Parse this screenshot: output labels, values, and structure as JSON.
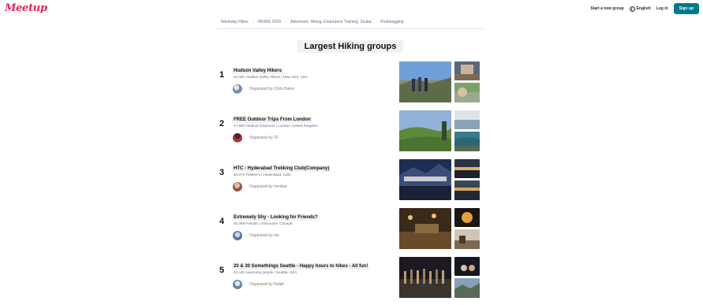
{
  "header": {
    "logo": "Meetup",
    "start_group": "Start a new group",
    "language": "English",
    "login": "Log in",
    "signup": "Sign up",
    "accent_color": "#00798a",
    "brand_color": "#e32359"
  },
  "breadcrumb": {
    "items": [
      "Weekday Hikes",
      "HIKING DOG",
      "Adventure, Hiking, Endurance Training, Scuba",
      "Peakbagging"
    ]
  },
  "page": {
    "title": "Largest Hiking groups"
  },
  "groups": [
    {
      "rank": "1",
      "name": "Hudson Valley Hikers",
      "meta": "54,481 Hudson Valley Hikers | New York, USA",
      "organizer": "Organized by Chris Baker"
    },
    {
      "rank": "2",
      "name": "FREE Outdoor Trips From London",
      "meta": "47,993 Outdoor Explorers | London, United Kingdom",
      "organizer": "Organized by TF"
    },
    {
      "rank": "3",
      "name": "HTC - Hyderabad Trekking Club(Company)",
      "meta": "46,074 Trekker's | Hyderabad, India",
      "organizer": "Organized by Venkee"
    },
    {
      "rank": "4",
      "name": "Extremely Shy - Looking for Friends?",
      "meta": "45,069 Friends | Vancouver, Canada",
      "organizer": "Organized by Ian"
    },
    {
      "rank": "5",
      "name": "20 & 30 Somethings Seattle - Happy hours to hikes - All fun!",
      "meta": "42,440 Awesome people | Seattle, USA",
      "organizer": "Organized by Ralph"
    }
  ]
}
